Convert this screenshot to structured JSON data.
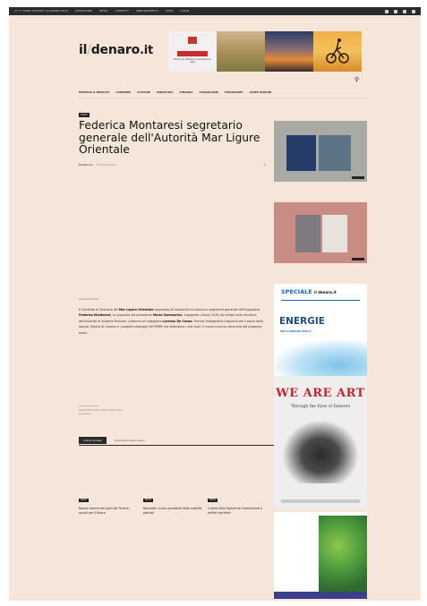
{
  "topbar": {
    "left": "21°C  TRANI    MARTEDÌ 14 MARZO 2023",
    "links": [
      "REDAZIONE",
      "NEWS",
      "CONTATTI",
      "ABBONAMENTO",
      "SHOP",
      "LOGIN"
    ]
  },
  "site": {
    "logo_main": "il",
    "logo_slash": "/",
    "logo_name": "denaro",
    "logo_tld": ".it"
  },
  "banner": {
    "b1_text": "Diserte per utilizzare le conoscenze in Italia"
  },
  "menu": [
    "IMPRESE & MERCATI",
    "CARRIERE",
    "CULTURE",
    "INDUSTRIA",
    "FINANZA",
    "CONSIGLIERI",
    "FINANZIARE",
    "ALTRE SEZIONI"
  ],
  "article": {
    "category": "NEWS",
    "title": "Federica Montaresi segretario generale dell'Autorità Mar Ligure Orientale",
    "author": "Redazione",
    "date": "14 Marzo 2023",
    "comments": "0",
    "caption": "Federica Montaresi",
    "body": [
      {
        "type": "text",
        "value": "Il Comitato di Gestione del "
      },
      {
        "type": "bold",
        "value": "Mar Ligure Orientale"
      },
      {
        "type": "text",
        "value": " approvato all'unanimità la nomina a segretario generale dell'ingegnere "
      },
      {
        "type": "bold",
        "value": "Federica Montaresi"
      },
      {
        "type": "text",
        "value": ", su proposta del presidente "
      },
      {
        "type": "bold",
        "value": "Mario Sommariva"
      },
      {
        "type": "text",
        "value": ". Ingegnere, classe 1976, da tempo nella struttura dell'Autorità di Sistema Portuale, subentra all'ingegnere "
      },
      {
        "type": "bold",
        "value": "Lorenzo De Cenzo"
      },
      {
        "type": "text",
        "value": ". Previsti impegnativi traguardi per il porto della Spezia, Marina di Carrara e i progetti strategici del PNRR che attendono i due scali. Il nuovo incarico decorrerà dal prossimo mese."
      }
    ],
    "footer_lines": [
      "Sostenibilità di Porto, Città e Spezia News",
      "Federica M"
    ]
  },
  "tabs": {
    "active": "Articoli correlati",
    "other": "Di più dello stesso autore"
  },
  "related": [
    {
      "category": "NEWS",
      "title": "Nuove nomine dei porti del Tirreno: spunti per il futuro"
    },
    {
      "category": "NEWS",
      "title": "Nominati i nuovi presidenti delle autorità portuali"
    },
    {
      "category": "NEWS",
      "title": "Il porto della Spezia tra investimenti e traffici marittimi"
    }
  ],
  "ads": {
    "speciale": "SPECIALE",
    "speciale_logo": "il denaro.it",
    "energie": "ENERGIE",
    "energie_sub": "PER CAMBIARE EPOCA",
    "we_are_art": "WE ARE ART",
    "through": "Through the Eyes of Dancers"
  },
  "icons": {
    "search": "search-icon",
    "social": [
      "facebook-icon",
      "instagram-icon",
      "twitter-icon",
      "youtube-icon"
    ]
  },
  "colors": {
    "page_bg": "#f6e6da",
    "topbar_bg": "#2b2b2b",
    "accent_red": "#c0262b",
    "blue": "#1c67b2"
  }
}
